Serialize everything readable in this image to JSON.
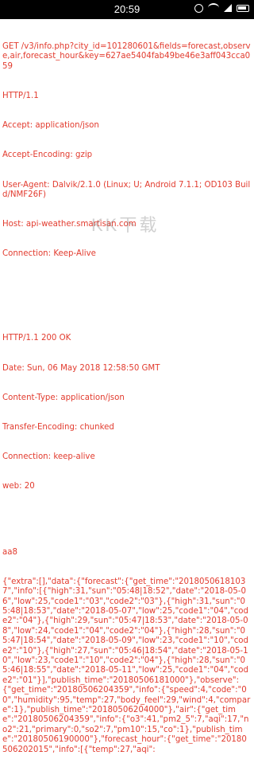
{
  "status_bar": {
    "time": "20:59",
    "icons": [
      "alarm-icon",
      "wifi-icon",
      "signal-icon",
      "battery-icon"
    ]
  },
  "request": {
    "lines": [
      "GET /v3/info.php?city_id=101280601&fields=forecast,observe,air,forecast_hour&key=627ae5404fab49be46e3aff043cca059",
      "HTTP/1.1",
      "Accept: application/json",
      "Accept-Encoding: gzip",
      "User-Agent: Dalvik/2.1.0 (Linux; U; Android 7.1.1; OD103 Build/NMF26F)",
      "Host: api-weather.smartisan.com",
      "Connection: Keep-Alive"
    ]
  },
  "response": {
    "lines": [
      "HTTP/1.1 200 OK",
      "Date: Sun, 06 May 2018 12:58:50 GMT",
      "Content-Type: application/json",
      "Transfer-Encoding: chunked",
      "Connection: keep-alive",
      "web: 20"
    ]
  },
  "body": {
    "chunk_size": "aa8",
    "text": "{\"extra\":[],\"data\":{\"forecast\":{\"get_time\":\"20180506181037\",\"info\":[{\"high\":31,\"sun\":\"05:48|18:52\",\"date\":\"2018-05-06\",\"low\":25,\"code1\":\"03\",\"code2\":\"03\"},{\"high\":31,\"sun\":\"05:48|18:53\",\"date\":\"2018-05-07\",\"low\":25,\"code1\":\"04\",\"code2\":\"04\"},{\"high\":29,\"sun\":\"05:47|18:53\",\"date\":\"2018-05-08\",\"low\":24,\"code1\":\"04\",\"code2\":\"04\"},{\"high\":28,\"sun\":\"05:47|18:54\",\"date\":\"2018-05-09\",\"low\":23,\"code1\":\"10\",\"code2\":\"10\"},{\"high\":27,\"sun\":\"05:46|18:54\",\"date\":\"2018-05-10\",\"low\":23,\"code1\":\"10\",\"code2\":\"04\"},{\"high\":28,\"sun\":\"05:46|18:55\",\"date\":\"2018-05-11\",\"low\":25,\"code1\":\"04\",\"code2\":\"01\"}],\"publish_time\":\"20180506181000\"},\"observe\":{\"get_time\":\"20180506204359\",\"info\":{\"speed\":4,\"code\":\"00\",\"humidity\":95,\"temp\":27,\"body_feel\":29,\"wind\":4,\"compare\":1},\"publish_time\":\"20180506204000\"},\"air\":{\"get_time\":\"20180506204359\",\"info\":{\"o3\":41,\"pm2_5\":7,\"aqi\":17,\"no2\":21,\"primary\":0,\"so2\":7,\"pm10\":15,\"co\":1},\"publish_time\":\"20180506190000\"},\"forecast_hour\":{\"get_time\":\"20180506202015\",\"info\":[{\"temp\":27,\"aqi\":"
  },
  "watermark": "KK下载",
  "colors": {
    "text": "#e23b2e",
    "status_bar_bg": "#000000"
  }
}
